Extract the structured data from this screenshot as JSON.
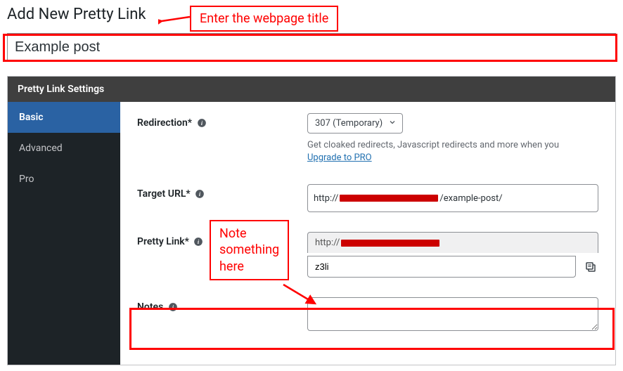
{
  "page_title": "Add New Pretty Link",
  "title_input": "Example post",
  "panel_header": "Pretty Link Settings",
  "tabs": [
    {
      "label": "Basic",
      "active": true
    },
    {
      "label": "Advanced",
      "active": false
    },
    {
      "label": "Pro",
      "active": false
    }
  ],
  "fields": {
    "redirection": {
      "label": "Redirection*",
      "value": "307 (Temporary)",
      "help_prefix": "Get cloaked redirects, Javascript redirects and more when you ",
      "help_link": "Upgrade to PRO"
    },
    "target_url": {
      "label": "Target URL*",
      "prefix": "http://",
      "suffix": "/example-post/"
    },
    "pretty_link": {
      "label": "Pretty Link*",
      "base_prefix": "http://",
      "slug": "z3li"
    },
    "notes": {
      "label": "Notes",
      "value": ""
    }
  },
  "annotations": {
    "title_hint": "Enter the webpage title",
    "notes_hint": "Note something here"
  }
}
